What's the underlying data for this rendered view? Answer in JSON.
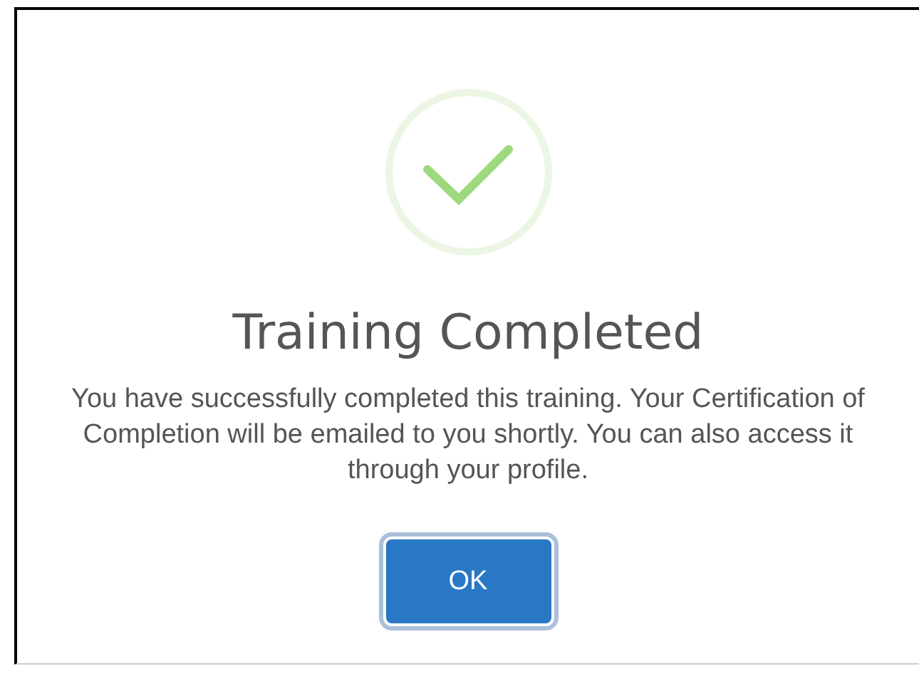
{
  "dialog": {
    "title": "Training Completed",
    "message": "You have successfully completed this training. Your Certification of Completion will be emailed to you shortly. You can also access it through your profile.",
    "buttons": [
      {
        "label": "OK",
        "kind": "primary"
      }
    ]
  }
}
